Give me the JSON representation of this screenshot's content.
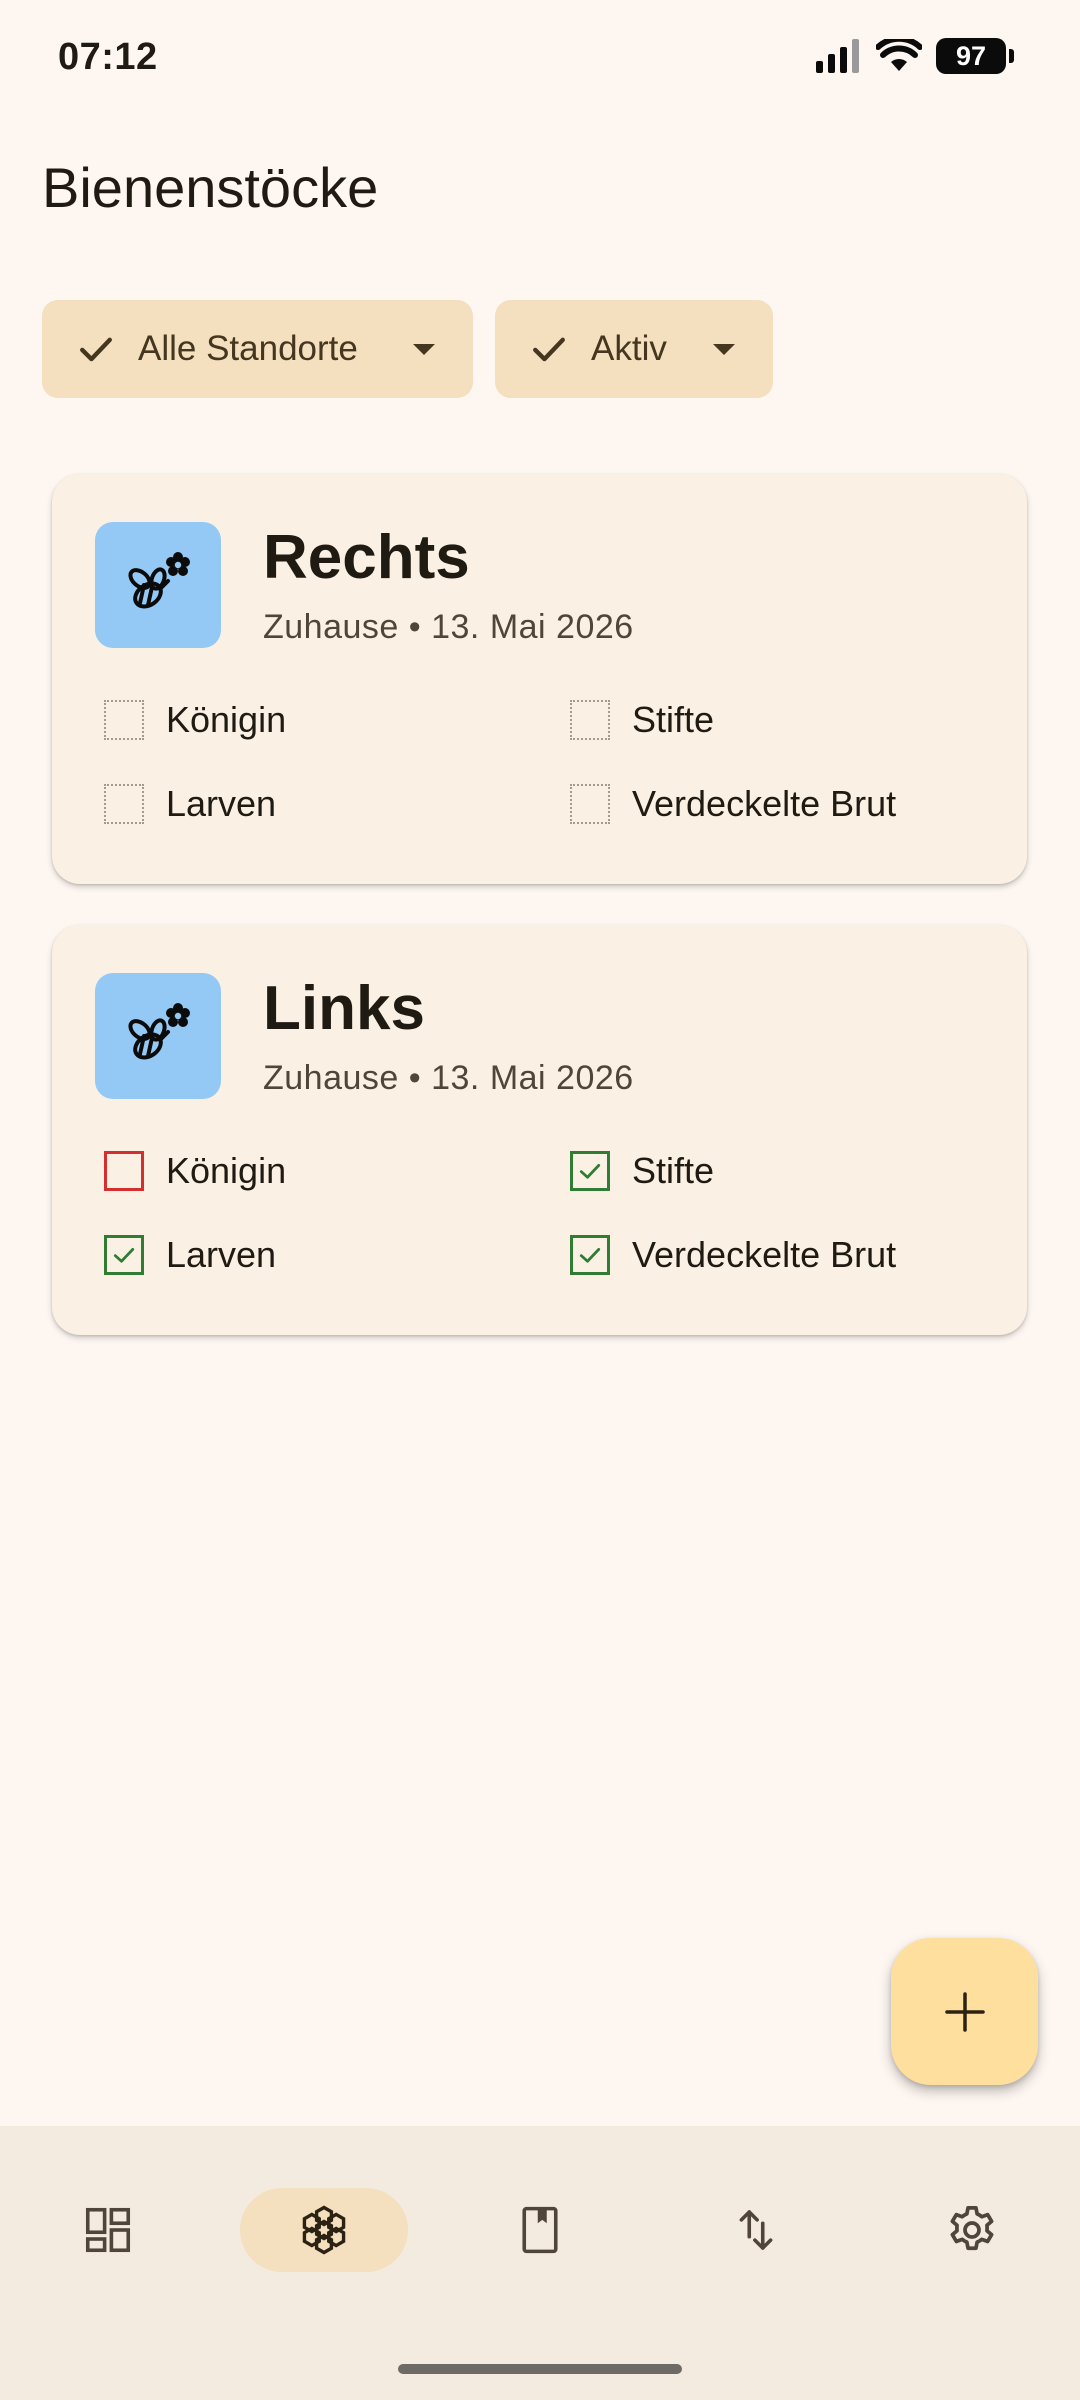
{
  "status_bar": {
    "time": "07:12",
    "battery": "97",
    "icons": [
      "signal-icon",
      "wifi-icon",
      "battery-icon"
    ]
  },
  "page_title": "Bienenstöcke",
  "filters": {
    "location": "Alle Standorte",
    "status": "Aktiv"
  },
  "hives": [
    {
      "name": "Rechts",
      "meta": "Zuhause • 13. Mai 2026",
      "checks": [
        {
          "label": "Königin",
          "state": "empty"
        },
        {
          "label": "Stifte",
          "state": "empty"
        },
        {
          "label": "Larven",
          "state": "empty"
        },
        {
          "label": "Verdeckelte Brut",
          "state": "empty"
        }
      ]
    },
    {
      "name": "Links",
      "meta": "Zuhause • 13. Mai 2026",
      "checks": [
        {
          "label": "Königin",
          "state": "unchecked"
        },
        {
          "label": "Stifte",
          "state": "checked"
        },
        {
          "label": "Larven",
          "state": "checked"
        },
        {
          "label": "Verdeckelte Brut",
          "state": "checked"
        }
      ]
    }
  ],
  "nav": {
    "items": [
      {
        "icon": "dashboard-icon",
        "active": false
      },
      {
        "icon": "hive-icon",
        "active": true
      },
      {
        "icon": "book-icon",
        "active": false
      },
      {
        "icon": "sync-icon",
        "active": false
      },
      {
        "icon": "settings-icon",
        "active": false
      }
    ]
  },
  "colors": {
    "background": "#FDF6F1",
    "chip": "#F4DFBE",
    "card": "#FAF0E4",
    "hive_icon_bg": "#94C9F5",
    "fab": "#FFDF9E",
    "nav_bg": "#F4EBE0",
    "checked": "#2E7D32",
    "unchecked": "#D32F2F"
  }
}
